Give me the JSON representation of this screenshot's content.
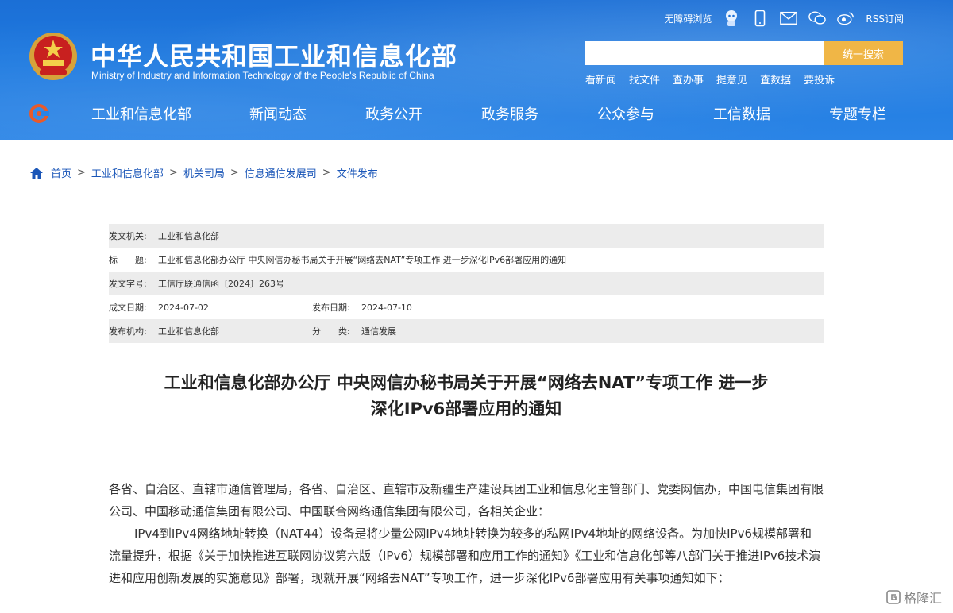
{
  "header": {
    "site_title": "中华人民共和国工业和信息化部",
    "site_subtitle": "Ministry of Industry and Information Technology of the People's Republic of China",
    "top_links": {
      "accessibility": "无障碍浏览",
      "rss": "RSS订阅"
    },
    "search": {
      "placeholder": "",
      "button": "统一搜索"
    },
    "quick_links": [
      "看新闻",
      "找文件",
      "查办事",
      "提意见",
      "查数据",
      "要投诉"
    ],
    "nav": [
      "工业和信息化部",
      "新闻动态",
      "政务公开",
      "政务服务",
      "公众参与",
      "工信数据",
      "专题专栏"
    ]
  },
  "breadcrumb": {
    "home": "首页",
    "items": [
      "工业和信息化部",
      "机关司局",
      "信息通信发展司",
      "文件发布"
    ]
  },
  "meta": {
    "issuer_label": "发文机关:",
    "issuer": "工业和信息化部",
    "title_label": "标　　题:",
    "title": "工业和信息化部办公厅 中央网信办秘书局关于开展“网络去NAT”专项工作 进一步深化IPv6部署应用的通知",
    "docno_label": "发文字号:",
    "docno": "工信厅联通信函〔2024〕263号",
    "created_label": "成文日期:",
    "created": "2024-07-02",
    "published_label": "发布日期:",
    "published": "2024-07-10",
    "org_label": "发布机构:",
    "org": "工业和信息化部",
    "category_label": "分　　类:",
    "category": "通信发展"
  },
  "doc": {
    "title_line1": "工业和信息化部办公厅 中央网信办秘书局关于开展“网络去NAT”专项工作 进一步",
    "title_line2": "深化IPv6部署应用的通知",
    "para1": "各省、自治区、直辖市通信管理局，各省、自治区、直辖市及新疆生产建设兵团工业和信息化主管部门、党委网信办，中国电信集团有限公司、中国移动通信集团有限公司、中国联合网络通信集团有限公司，各相关企业：",
    "para2": "IPv4到IPv4网络地址转换（NAT44）设备是将少量公网IPv4地址转换为较多的私网IPv4地址的网络设备。为加快IPv6规模部署和流量提升，根据《关于加快推进互联网协议第六版（IPv6）规模部署和应用工作的通知》《工业和信息化部等八部门关于推进IPv6技术演进和应用创新发展的实施意见》部署，现就开展“网络去NAT”专项工作，进一步深化IPv6部署应用有关事项通知如下："
  },
  "watermark": "格隆汇"
}
